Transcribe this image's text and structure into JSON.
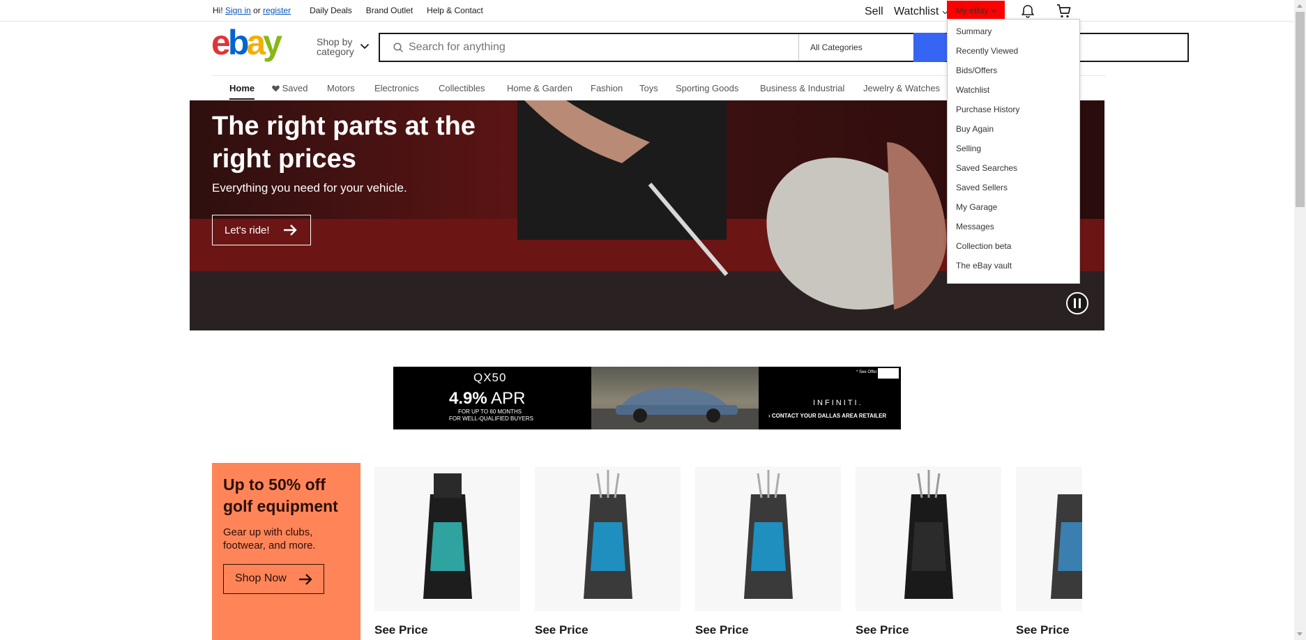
{
  "topbar": {
    "greeting": "Hi!",
    "sign_in": "Sign in",
    "or": "or",
    "register": "register",
    "links": [
      "Daily Deals",
      "Brand Outlet",
      "Help & Contact"
    ],
    "sell": "Sell",
    "watchlist": "Watchlist",
    "my_ebay": "My eBay",
    "my_ebay_highlight": "#ff0000"
  },
  "dropdown": {
    "items": [
      "Summary",
      "Recently Viewed",
      "Bids/Offers",
      "Watchlist",
      "Purchase History",
      "Buy Again",
      "Selling",
      "Saved Searches",
      "Saved Sellers",
      "My Garage",
      "Messages",
      "Collection beta",
      "The eBay vault"
    ]
  },
  "header": {
    "logo_letters": [
      "e",
      "b",
      "a",
      "y"
    ],
    "logo_colors": [
      "#e53238",
      "#0064d2",
      "#f5af02",
      "#86b817"
    ],
    "shop_by_line1": "Shop by",
    "shop_by_line2": "category",
    "search_placeholder": "Search for anything",
    "category_select": "All Categories",
    "search_button_color": "#3665f3"
  },
  "nav": {
    "items": [
      "Home",
      "Saved",
      "Motors",
      "Electronics",
      "Collectibles",
      "Home & Garden",
      "Fashion",
      "Toys",
      "Sporting Goods",
      "Business & Industrial",
      "Jewelry & Watches"
    ]
  },
  "hero": {
    "title": "The right parts at the right prices",
    "subtitle": "Everything you need for your vehicle.",
    "cta": "Let's ride!"
  },
  "ad": {
    "model": "QX50",
    "apr_value": "4.9%",
    "apr_unit": "APR",
    "fine_line1": "FOR UP TO 60 MONTHS",
    "fine_line2": "FOR WELL-QUALIFIED BUYERS",
    "brand": "INFINITI.",
    "cta": "› CONTACT YOUR DALLAS AREA RETAILER",
    "see_offer": "* See Offer"
  },
  "promo": {
    "title": "Up to 50% off golf equipment",
    "subtitle": "Gear up with clubs, footwear, and more.",
    "button": "Shop Now",
    "bg_color": "#ff8559"
  },
  "products": [
    {
      "price": "See Price",
      "bag_color": "#2fa3a0"
    },
    {
      "price": "See Price",
      "bag_color": "#1f8fbf"
    },
    {
      "price": "See Price",
      "bag_color": "#1f8fbf"
    },
    {
      "price": "See Price",
      "bag_color": "#2b2b2b"
    },
    {
      "price": "See Price",
      "bag_color": "#3a7fb0"
    }
  ]
}
